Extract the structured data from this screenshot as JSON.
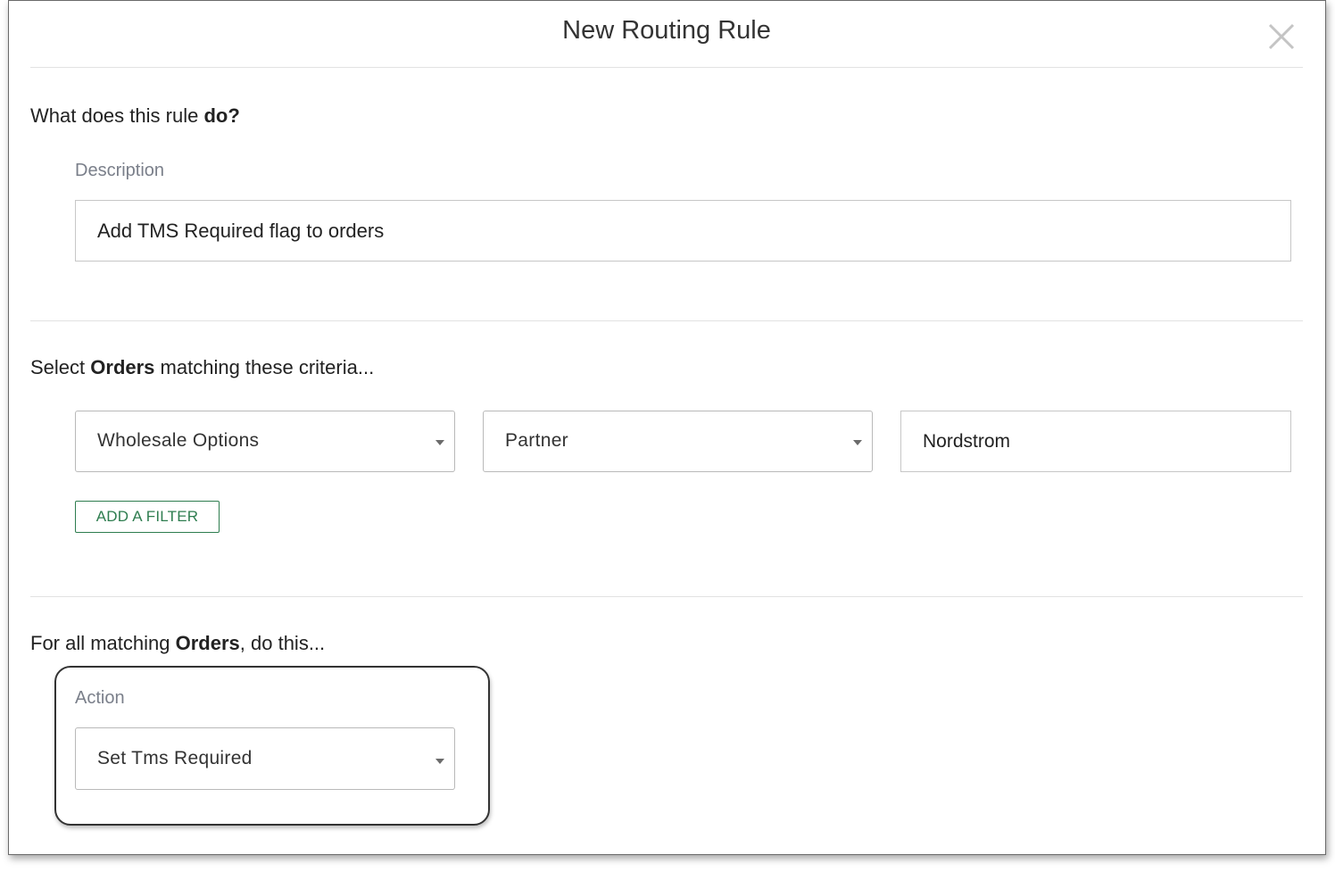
{
  "modal": {
    "title": "New Routing Rule"
  },
  "description_section": {
    "heading_prefix": "What does this rule ",
    "heading_bold": "do?",
    "label": "Description",
    "value": "Add TMS Required flag to orders"
  },
  "criteria_section": {
    "heading_prefix": "Select ",
    "heading_bold": "Orders",
    "heading_suffix": " matching these criteria...",
    "filter_group": "Wholesale Options",
    "filter_field": "Partner",
    "filter_value": "Nordstrom",
    "add_filter_label": "ADD A FILTER"
  },
  "action_section": {
    "heading_prefix": "For all matching ",
    "heading_bold": "Orders",
    "heading_suffix": ", do this...",
    "label": "Action",
    "selected": "Set Tms Required"
  },
  "colors": {
    "accent_green": "#2e7d4f",
    "label_gray": "#7a7f8a",
    "border_gray": "#c7c7c7"
  }
}
